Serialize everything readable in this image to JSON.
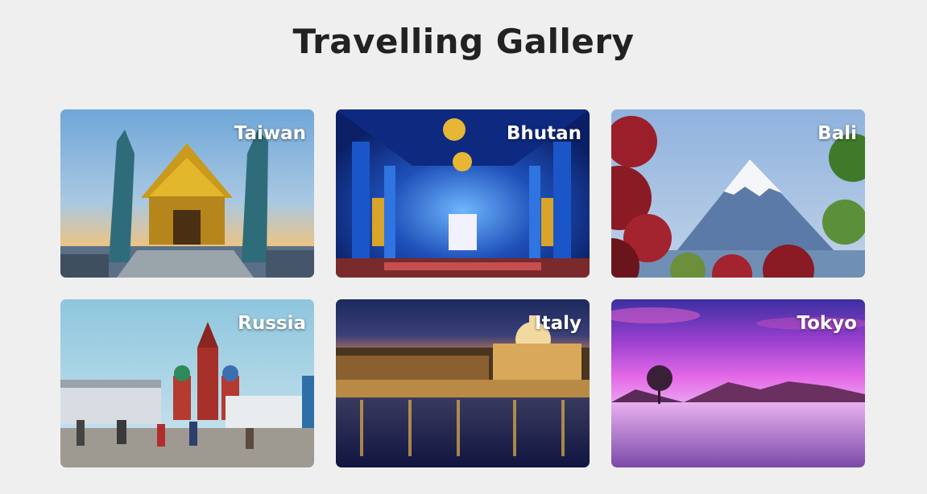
{
  "page": {
    "title": "Travelling Gallery"
  },
  "gallery": {
    "items": [
      {
        "label": "Taiwan",
        "scene": "golden-temple-with-serpent-statues"
      },
      {
        "label": "Bhutan",
        "scene": "blue-temple-interior"
      },
      {
        "label": "Bali",
        "scene": "snow-capped-mountain-with-red-maple"
      },
      {
        "label": "Russia",
        "scene": "red-square-cathedral"
      },
      {
        "label": "Italy",
        "scene": "night-river-bridge-with-dome"
      },
      {
        "label": "Tokyo",
        "scene": "purple-sunset-lake-with-lone-tree"
      }
    ]
  }
}
